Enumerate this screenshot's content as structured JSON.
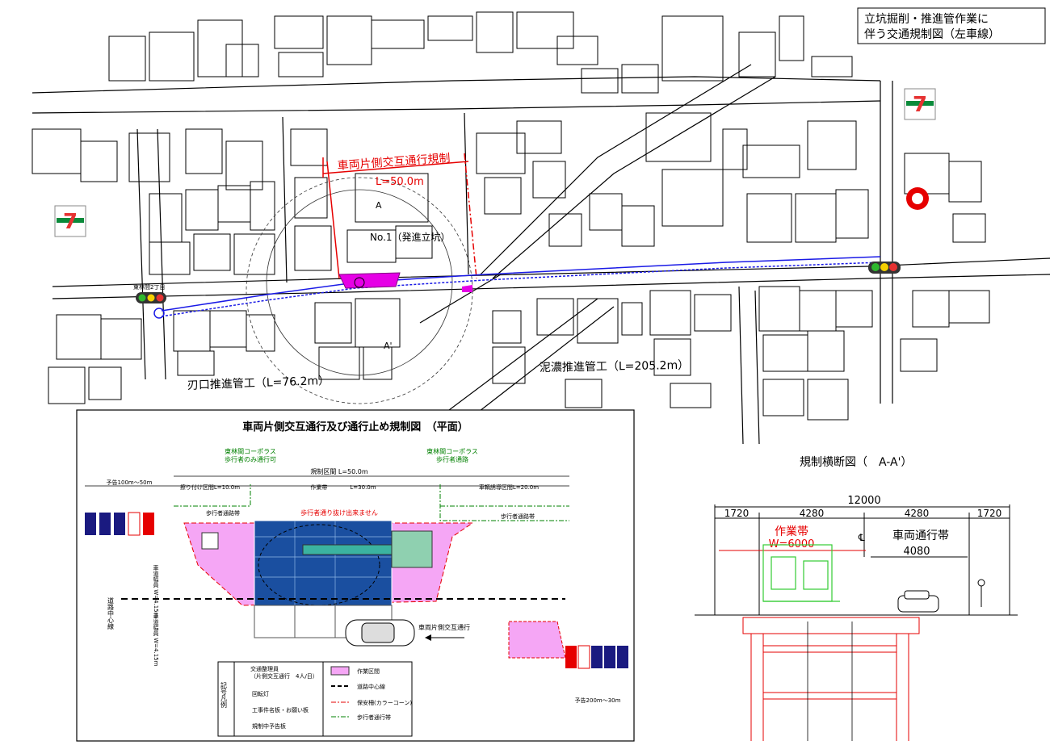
{
  "title_box": {
    "line1": "立坑掘削・推進管作業に",
    "line2": "伴う交通規制図（左車線）"
  },
  "map": {
    "regulation_label": "車両片側交互通行規制",
    "regulation_length": "L=50.0m",
    "shaft_label": "No.1（発進立坑）",
    "section_a": "A",
    "section_a_prime": "A'",
    "pipe_left": "刃口推進管工（L=76.2m）",
    "pipe_right": "泥濃推進管工（L=205.2m）",
    "signal_left_label": "東林間2丁目",
    "colors": {
      "pipe": "#1a1ae6",
      "regulation": "#e60000",
      "work_area": "#e600e6"
    }
  },
  "plan": {
    "title": "車両片側交互通行及び通行止め規制図　（平面）",
    "crosswalk_left": [
      "東林間コーポラス",
      "歩行者のみ通行可"
    ],
    "crosswalk_right": [
      "東林間コーポラス",
      "歩行者通路"
    ],
    "regulation_section": "規制区間 L=50.0m",
    "notice_left": "予告100m～50m",
    "taper_left": "擦り付け区間L=10.0m",
    "work_zone": "作業帯　　　　L=30.0m",
    "buffer_right": "車輌誘導区間L=20.0m",
    "ped_lane_left": "歩行者通路帯",
    "ped_lane_right": "歩行者通路帯",
    "no_pass": "歩行者通り抜け出来ません",
    "one_way_label": "車両片側交互通行",
    "width_upper": "車道幅員 W=4.15m",
    "width_lower": "車道幅員 W=4.15m",
    "centerline": "道路中心線",
    "notice_right": "予告200m～30m",
    "legend": {
      "title": "記号凡例",
      "items_left": [
        "交通整理員",
        "（片側交互通行　4人/日）",
        "回転灯",
        "工事件名板・お願い板",
        "規制中予告板"
      ],
      "items_right": [
        "作業区間",
        "道路中心線",
        "保安柵(カラーコーン)",
        "歩行者通行帯"
      ]
    }
  },
  "section": {
    "title": "規制横断図（　A-A'）",
    "total": "12000",
    "dims": [
      "1720",
      "4280",
      "4280",
      "1720"
    ],
    "work_label": "作業帯",
    "work_width": "W=6000",
    "lane_label": "車両通行帯",
    "lane_width": "4080",
    "cl": "℄"
  }
}
